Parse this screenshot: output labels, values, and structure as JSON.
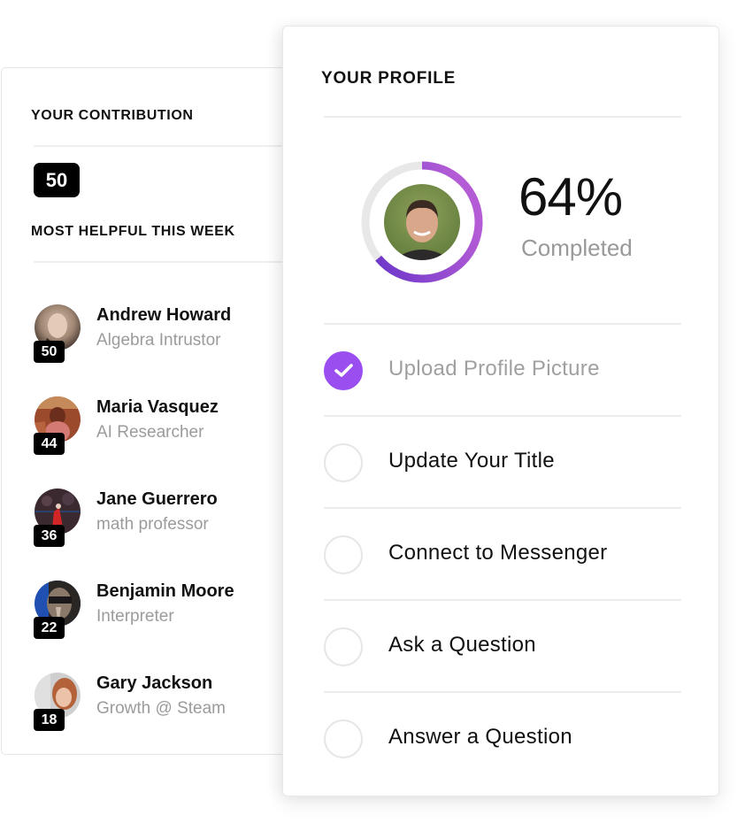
{
  "contribution": {
    "title": "YOUR CONTRIBUTION",
    "score": "50"
  },
  "most_helpful": {
    "title": "MOST HELPFUL THIS WEEK",
    "people": [
      {
        "name": "Andrew Howard",
        "role": "Algebra Intrustor",
        "score": "50",
        "avatar": "avatar-photo-andrew-howard"
      },
      {
        "name": "Maria Vasquez",
        "role": "AI Researcher",
        "score": "44",
        "avatar": "avatar-photo-maria-vasquez"
      },
      {
        "name": "Jane Guerrero",
        "role": "math professor",
        "score": "36",
        "avatar": "avatar-photo-jane-guerrero"
      },
      {
        "name": "Benjamin Moore",
        "role": "Interpreter",
        "score": "22",
        "avatar": "avatar-photo-benjamin-moore"
      },
      {
        "name": "Gary Jackson",
        "role": "Growth @ Steam",
        "score": "18",
        "avatar": "avatar-photo-gary-jackson"
      }
    ]
  },
  "profile": {
    "title": "YOUR PROFILE",
    "progress_percent": 64,
    "percent_label": "64%",
    "completed_label": "Completed",
    "colors": {
      "ring_start": "#6433c8",
      "ring_end": "#b45cd6",
      "ring_track": "#e8e8e8",
      "check_done": "#9b4ef0"
    },
    "tasks": [
      {
        "label": "Upload Profile Picture",
        "done": true,
        "icon": "check-icon"
      },
      {
        "label": "Update Your Title",
        "done": false,
        "icon": "empty-circle-icon"
      },
      {
        "label": "Connect to Messenger",
        "done": false,
        "icon": "empty-circle-icon"
      },
      {
        "label": "Ask a Question",
        "done": false,
        "icon": "empty-circle-icon"
      },
      {
        "label": "Answer a Question",
        "done": false,
        "icon": "empty-circle-icon"
      }
    ]
  }
}
